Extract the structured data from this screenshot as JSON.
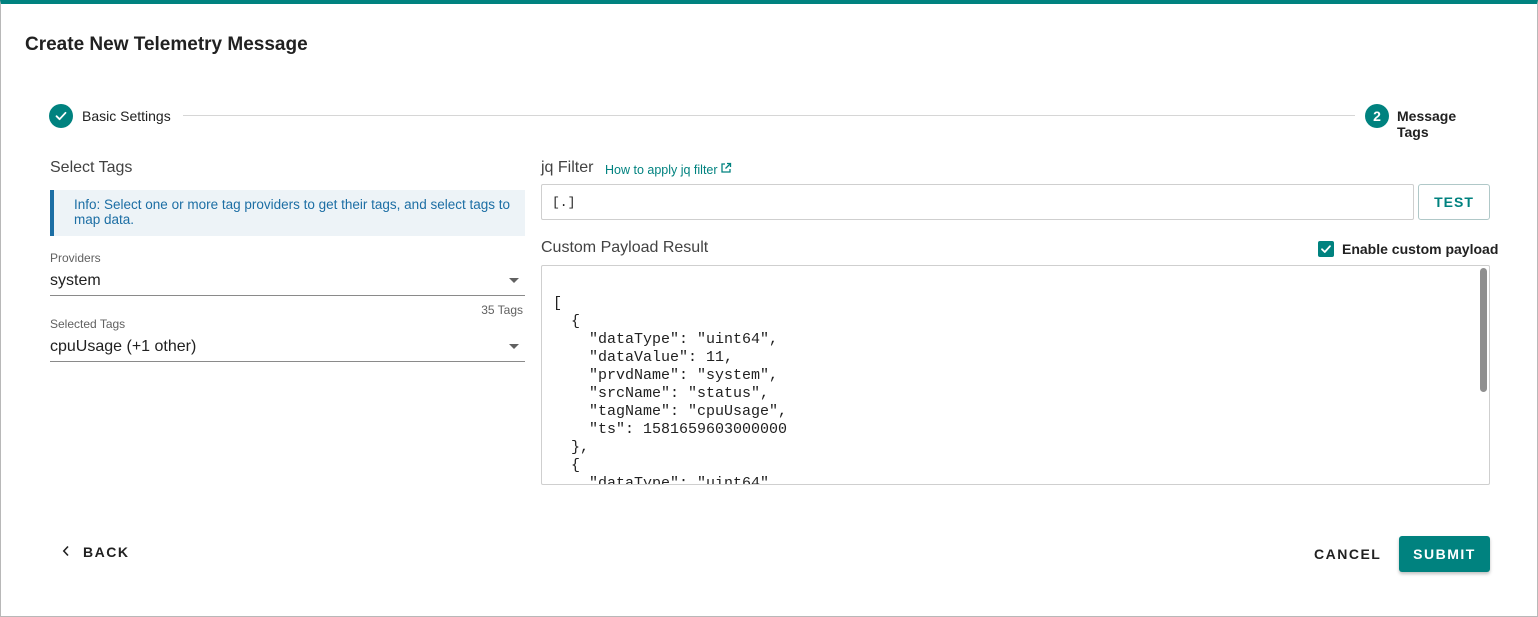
{
  "dialog": {
    "title": "Create New Telemetry Message"
  },
  "stepper": {
    "step1": {
      "label": "Basic Settings",
      "state": "completed"
    },
    "step2": {
      "number": "2",
      "label": "Message Tags",
      "state": "active"
    }
  },
  "left": {
    "section_label": "Select Tags",
    "info": "Info: Select one or more tag providers to get their tags, and select tags to map data.",
    "providers": {
      "label": "Providers",
      "value": "system",
      "count": "35 Tags"
    },
    "selected_tags": {
      "label": "Selected Tags",
      "value": "cpuUsage (+1 other)"
    }
  },
  "right": {
    "jq_label": "jq Filter",
    "jq_link": "How to apply jq filter",
    "jq_value": "[.]",
    "test_label": "TEST",
    "payload_label": "Custom Payload Result",
    "enable_custom_label": "Enable custom payload",
    "enable_custom_checked": true,
    "payload_text": "[\n  {\n    \"dataType\": \"uint64\",\n    \"dataValue\": 11,\n    \"prvdName\": \"system\",\n    \"srcName\": \"status\",\n    \"tagName\": \"cpuUsage\",\n    \"ts\": 1581659603000000\n  },\n  {\n    \"dataType\": \"uint64\","
  },
  "footer": {
    "back_label": "BACK",
    "cancel_label": "CANCEL",
    "submit_label": "SUBMIT"
  },
  "colors": {
    "accent": "#00827f",
    "info_text": "#1c6ea4",
    "info_bg": "#edf3f7"
  }
}
